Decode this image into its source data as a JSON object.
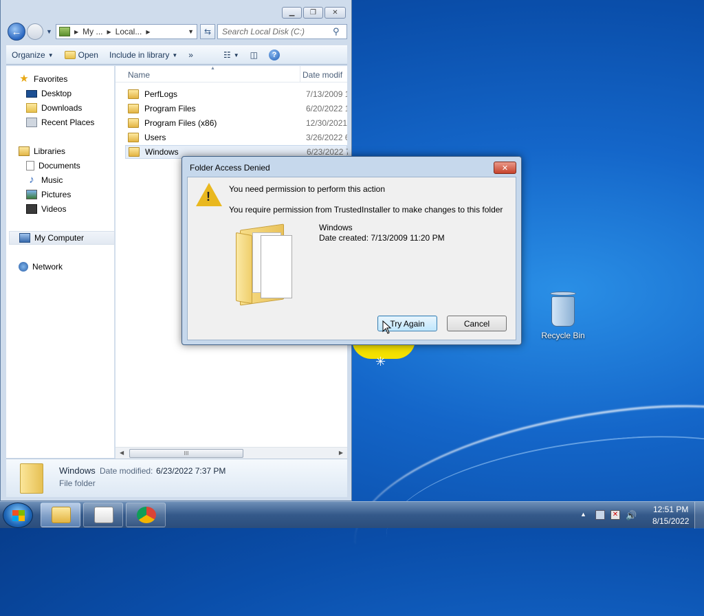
{
  "explorer": {
    "address": {
      "crumb1": "My ...",
      "crumb2": "Local..."
    },
    "search": {
      "placeholder": "Search Local Disk (C:)"
    },
    "toolbar": {
      "organize": "Organize",
      "open": "Open",
      "include": "Include in library",
      "more": "»"
    },
    "nav": {
      "favorites": "Favorites",
      "desktop": "Desktop",
      "downloads": "Downloads",
      "recent": "Recent Places",
      "libraries": "Libraries",
      "documents": "Documents",
      "music": "Music",
      "pictures": "Pictures",
      "videos": "Videos",
      "computer": "My Computer",
      "network": "Network"
    },
    "columns": {
      "name": "Name",
      "date": "Date modif"
    },
    "files": [
      {
        "name": "PerfLogs",
        "date": "7/13/2009 1"
      },
      {
        "name": "Program Files",
        "date": "6/20/2022 1"
      },
      {
        "name": "Program Files (x86)",
        "date": "12/30/2021"
      },
      {
        "name": "Users",
        "date": "3/26/2022 6"
      },
      {
        "name": "Windows",
        "date": "6/23/2022 7"
      }
    ],
    "scroll_grip": "III",
    "details": {
      "name": "Windows",
      "modified_label": "Date modified:",
      "modified_value": "6/23/2022 7:37 PM",
      "type": "File folder"
    }
  },
  "dialog": {
    "title": "Folder Access Denied",
    "heading": "You need permission to perform this action",
    "message": "You require permission from TrustedInstaller to make changes to this folder",
    "folder_name": "Windows",
    "folder_date": "Date created: 7/13/2009 11:20 PM",
    "try_again": "Try Again",
    "cancel": "Cancel"
  },
  "desktop": {
    "recycle_bin": "Recycle Bin"
  },
  "taskbar": {
    "time": "12:51 PM",
    "date": "8/15/2022"
  }
}
